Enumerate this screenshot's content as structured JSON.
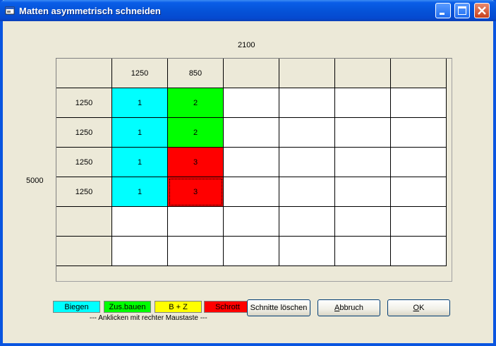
{
  "window": {
    "title": "Matten asymmetrisch schneiden"
  },
  "dims": {
    "width": "2100",
    "height": "5000"
  },
  "grid": {
    "col_headers": [
      "1250",
      "850",
      "",
      "",
      "",
      "",
      ""
    ],
    "rows": [
      {
        "label": "1250",
        "cells": [
          {
            "text": "1",
            "color": "cyan"
          },
          {
            "text": "2",
            "color": "green"
          },
          {
            "text": "",
            "color": "white"
          },
          {
            "text": "",
            "color": "white"
          },
          {
            "text": "",
            "color": "white"
          },
          {
            "text": "",
            "color": "white"
          }
        ]
      },
      {
        "label": "1250",
        "cells": [
          {
            "text": "1",
            "color": "cyan"
          },
          {
            "text": "2",
            "color": "green"
          },
          {
            "text": "",
            "color": "white"
          },
          {
            "text": "",
            "color": "white"
          },
          {
            "text": "",
            "color": "white"
          },
          {
            "text": "",
            "color": "white"
          }
        ]
      },
      {
        "label": "1250",
        "cells": [
          {
            "text": "1",
            "color": "cyan"
          },
          {
            "text": "3",
            "color": "red"
          },
          {
            "text": "",
            "color": "white"
          },
          {
            "text": "",
            "color": "white"
          },
          {
            "text": "",
            "color": "white"
          },
          {
            "text": "",
            "color": "white"
          }
        ]
      },
      {
        "label": "1250",
        "cells": [
          {
            "text": "1",
            "color": "cyan"
          },
          {
            "text": "3",
            "color": "red",
            "focused": true
          },
          {
            "text": "",
            "color": "white"
          },
          {
            "text": "",
            "color": "white"
          },
          {
            "text": "",
            "color": "white"
          },
          {
            "text": "",
            "color": "white"
          }
        ]
      },
      {
        "label": "",
        "cells": [
          {
            "text": "",
            "color": "white"
          },
          {
            "text": "",
            "color": "white"
          },
          {
            "text": "",
            "color": "white"
          },
          {
            "text": "",
            "color": "white"
          },
          {
            "text": "",
            "color": "white"
          },
          {
            "text": "",
            "color": "white"
          }
        ]
      },
      {
        "label": "",
        "cells": [
          {
            "text": "",
            "color": "white"
          },
          {
            "text": "",
            "color": "white"
          },
          {
            "text": "",
            "color": "white"
          },
          {
            "text": "",
            "color": "white"
          },
          {
            "text": "",
            "color": "white"
          },
          {
            "text": "",
            "color": "white"
          }
        ]
      }
    ]
  },
  "legend": [
    {
      "label": "Biegen",
      "color": "#00ffff"
    },
    {
      "label": "Zus.bauen",
      "color": "#00ff00"
    },
    {
      "label": "B + Z",
      "color": "#ffff00"
    },
    {
      "label": "Schrott",
      "color": "#ff0000"
    }
  ],
  "hint": "--- Anklicken mit rechter Maustaste ---",
  "buttons": {
    "clear": "Schnitte löschen",
    "cancel_pre": "",
    "cancel_key": "A",
    "cancel_post": "bbruch",
    "ok_key": "O",
    "ok_post": "K"
  }
}
